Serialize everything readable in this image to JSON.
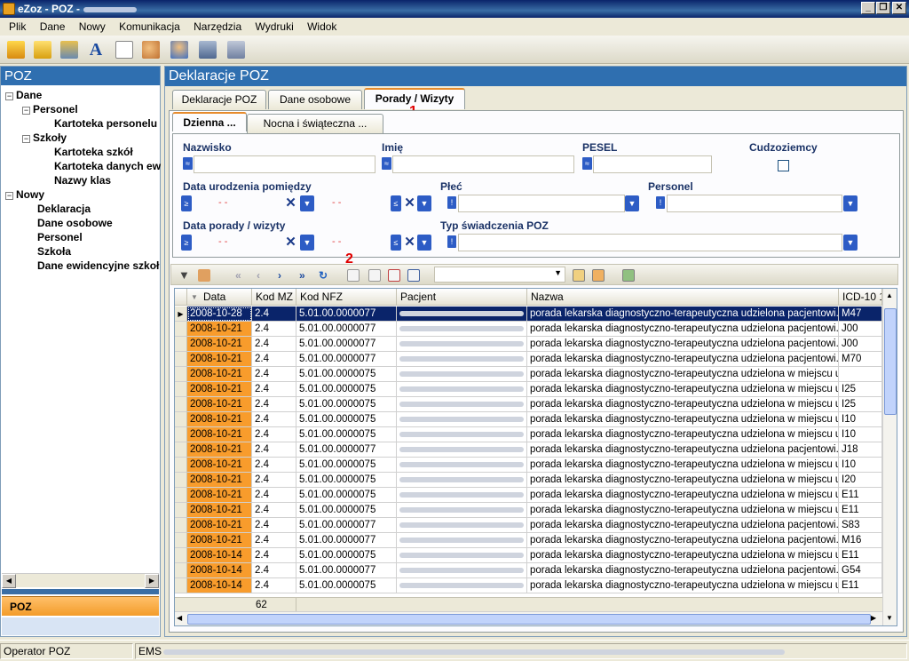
{
  "window": {
    "title": "eZoz - POZ -"
  },
  "menu": [
    "Plik",
    "Dane",
    "Nowy",
    "Komunikacja",
    "Narzędzia",
    "Wydruki",
    "Widok"
  ],
  "left": {
    "title": "POZ",
    "tree": {
      "dane": "Dane",
      "personel": "Personel",
      "kartoteka_personelu": "Kartoteka personelu",
      "szkoly": "Szkoły",
      "kartoteka_szkol": "Kartoteka szkół",
      "kartoteka_danych": "Kartoteka danych ew",
      "nazwy_klas": "Nazwy klas",
      "nowy": "Nowy",
      "deklaracja": "Deklaracja",
      "dane_osobowe": "Dane osobowe",
      "personel2": "Personel",
      "szkola": "Szkoła",
      "dane_ewidencyjne": "Dane ewidencyjne szkoł"
    },
    "section": "POZ"
  },
  "right": {
    "title": "Deklaracje POZ",
    "tabs": [
      "Deklaracje POZ",
      "Dane osobowe",
      "Porady / Wizyty"
    ],
    "subtabs": [
      "Dzienna ...",
      "Nocna i świąteczna ..."
    ],
    "filters": {
      "nazwisko": "Nazwisko",
      "imie": "Imię",
      "pesel": "PESEL",
      "cudzoziemcy": "Cudzoziemcy",
      "data_urodzenia": "Data urodzenia pomiędzy",
      "plec": "Płeć",
      "personel": "Personel",
      "data_porady": "Data porady / wizyty",
      "typ_swiadczenia": "Typ świadczenia POZ",
      "date_placeholder": "- -"
    },
    "annotations": {
      "one": "1",
      "two": "2"
    }
  },
  "grid": {
    "columns": [
      "Data",
      "Kod MZ",
      "Kod NFZ",
      "Pacjent",
      "Nazwa",
      "ICD-10 1"
    ],
    "rows": [
      [
        "2008-10-28",
        "2.4",
        "5.01.00.0000077",
        "porada  lekarska  diagnostyczno-terapeutyczna  udzielona  pacjentowi...",
        "M47"
      ],
      [
        "2008-10-21",
        "2.4",
        "5.01.00.0000077",
        "porada  lekarska  diagnostyczno-terapeutyczna  udzielona  pacjentowi...",
        "J00"
      ],
      [
        "2008-10-21",
        "2.4",
        "5.01.00.0000077",
        "porada  lekarska  diagnostyczno-terapeutyczna  udzielona  pacjentowi...",
        "J00"
      ],
      [
        "2008-10-21",
        "2.4",
        "5.01.00.0000077",
        "porada  lekarska  diagnostyczno-terapeutyczna  udzielona  pacjentowi...",
        "M70"
      ],
      [
        "2008-10-21",
        "2.4",
        "5.01.00.0000075",
        "porada  lekarska  diagnostyczno-terapeutyczna  udzielona  w  miejscu  u...",
        ""
      ],
      [
        "2008-10-21",
        "2.4",
        "5.01.00.0000075",
        "porada  lekarska  diagnostyczno-terapeutyczna  udzielona  w  miejscu  u...",
        "I25"
      ],
      [
        "2008-10-21",
        "2.4",
        "5.01.00.0000075",
        "porada  lekarska  diagnostyczno-terapeutyczna  udzielona  w  miejscu  u...",
        "I25"
      ],
      [
        "2008-10-21",
        "2.4",
        "5.01.00.0000075",
        "porada  lekarska  diagnostyczno-terapeutyczna  udzielona  w  miejscu  u...",
        "I10"
      ],
      [
        "2008-10-21",
        "2.4",
        "5.01.00.0000075",
        "porada  lekarska  diagnostyczno-terapeutyczna  udzielona  w  miejscu  u...",
        "I10"
      ],
      [
        "2008-10-21",
        "2.4",
        "5.01.00.0000077",
        "porada  lekarska  diagnostyczno-terapeutyczna  udzielona  pacjentowi...",
        "J18"
      ],
      [
        "2008-10-21",
        "2.4",
        "5.01.00.0000075",
        "porada  lekarska  diagnostyczno-terapeutyczna  udzielona  w  miejscu  u...",
        "I10"
      ],
      [
        "2008-10-21",
        "2.4",
        "5.01.00.0000075",
        "porada  lekarska  diagnostyczno-terapeutyczna  udzielona  w  miejscu  u...",
        "I20"
      ],
      [
        "2008-10-21",
        "2.4",
        "5.01.00.0000075",
        "porada  lekarska  diagnostyczno-terapeutyczna  udzielona  w  miejscu  u...",
        "E11"
      ],
      [
        "2008-10-21",
        "2.4",
        "5.01.00.0000075",
        "porada  lekarska  diagnostyczno-terapeutyczna  udzielona  w  miejscu  u...",
        "E11"
      ],
      [
        "2008-10-21",
        "2.4",
        "5.01.00.0000077",
        "porada  lekarska  diagnostyczno-terapeutyczna  udzielona  pacjentowi...",
        "S83"
      ],
      [
        "2008-10-21",
        "2.4",
        "5.01.00.0000077",
        "porada  lekarska  diagnostyczno-terapeutyczna  udzielona  pacjentowi...",
        "M16"
      ],
      [
        "2008-10-14",
        "2.4",
        "5.01.00.0000075",
        "porada  lekarska  diagnostyczno-terapeutyczna  udzielona  w  miejscu  u...",
        "E11"
      ],
      [
        "2008-10-14",
        "2.4",
        "5.01.00.0000077",
        "porada  lekarska  diagnostyczno-terapeutyczna  udzielona  pacjentowi...",
        "G54"
      ],
      [
        "2008-10-14",
        "2.4",
        "5.01.00.0000075",
        "porada  lekarska  diagnostyczno-terapeutyczna  udzielona  w  miejscu  u...",
        "E11"
      ]
    ],
    "footer_count": "62"
  },
  "status": {
    "operator": "Operator POZ",
    "ems": "EMS"
  },
  "colors": {
    "accent": "#2f6fb0",
    "date_cell": "#f89c2c",
    "selected": "#0a246a"
  }
}
